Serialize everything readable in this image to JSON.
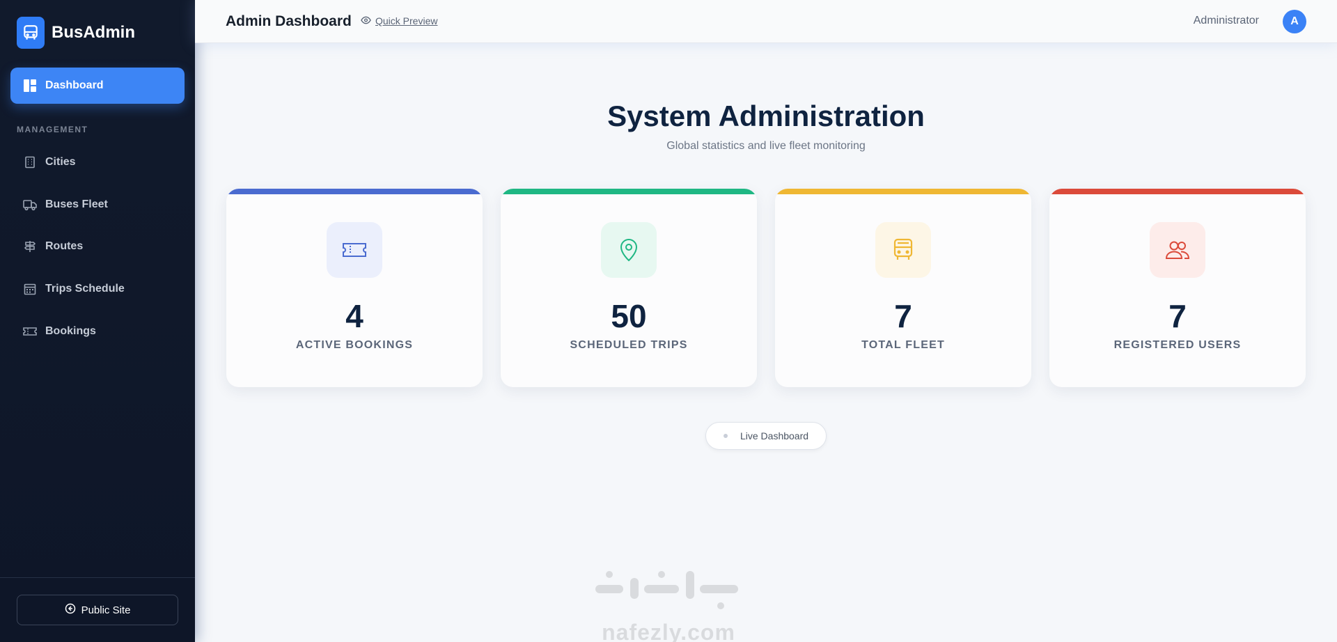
{
  "brand": {
    "name": "BusAdmin"
  },
  "sidebar": {
    "active": {
      "label": "Dashboard"
    },
    "section_label": "MANAGEMENT",
    "items": [
      {
        "label": "Cities",
        "icon": "building-icon"
      },
      {
        "label": "Buses Fleet",
        "icon": "truck-icon"
      },
      {
        "label": "Routes",
        "icon": "signpost-icon"
      },
      {
        "label": "Trips Schedule",
        "icon": "calendar-icon"
      },
      {
        "label": "Bookings",
        "icon": "ticket-icon"
      }
    ],
    "public_site": "Public Site"
  },
  "header": {
    "title": "Admin Dashboard",
    "quick_preview": "Quick Preview",
    "user_name": "Administrator",
    "avatar_letter": "A"
  },
  "main": {
    "title": "System Administration",
    "subtitle": "Global statistics and live fleet monitoring",
    "live_label": "Live Dashboard"
  },
  "stats": [
    {
      "value": "4",
      "label": "ACTIVE BOOKINGS",
      "color": "#4a6bd0",
      "icon": "ticket-icon"
    },
    {
      "value": "50",
      "label": "SCHEDULED TRIPS",
      "color": "#1fb783",
      "icon": "map-pin-icon"
    },
    {
      "value": "7",
      "label": "TOTAL FLEET",
      "color": "#efb733",
      "icon": "bus-icon"
    },
    {
      "value": "7",
      "label": "REGISTERED USERS",
      "color": "#db4a3a",
      "icon": "users-icon"
    }
  ],
  "watermark": {
    "text": "nafezly.com"
  }
}
